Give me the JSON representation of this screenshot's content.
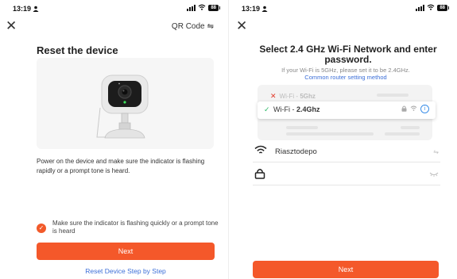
{
  "left": {
    "status": {
      "time": "13:19",
      "battery": "88"
    },
    "qr_code_label": "QR Code",
    "title": "Reset the device",
    "instruction": "Power on the device and make sure the indicator is flashing rapidly or a prompt tone is heard.",
    "confirm_text": "Make sure the indicator is flashing quickly or a prompt tone is heard",
    "confirm_checked": true,
    "next_label": "Next",
    "reset_link": "Reset Device Step by Step"
  },
  "right": {
    "status": {
      "time": "13:19",
      "battery": "88"
    },
    "title": "Select 2.4 GHz Wi-Fi Network and enter password.",
    "hint": "If your Wi-Fi is 5GHz, please set it to be 2.4GHz.",
    "hint_link": "Common router setting method",
    "illustration": {
      "bad_label": "Wi-Fi - ",
      "bad_band": "5Ghz",
      "good_label": "Wi-Fi - ",
      "good_band": "2.4Ghz"
    },
    "ssid_value": "Riasztodepo",
    "password_value": "",
    "next_label": "Next"
  },
  "colors": {
    "accent": "#f4582a",
    "link": "#3c6fd8",
    "ok": "#29b765",
    "bad": "#e23a2a"
  },
  "icons": [
    "person-icon",
    "signal-icon",
    "wifi-icon",
    "battery-icon",
    "close-icon",
    "qr-switch-icon",
    "check-icon",
    "lock-icon",
    "info-icon",
    "swap-icon",
    "eye-closed-icon"
  ]
}
